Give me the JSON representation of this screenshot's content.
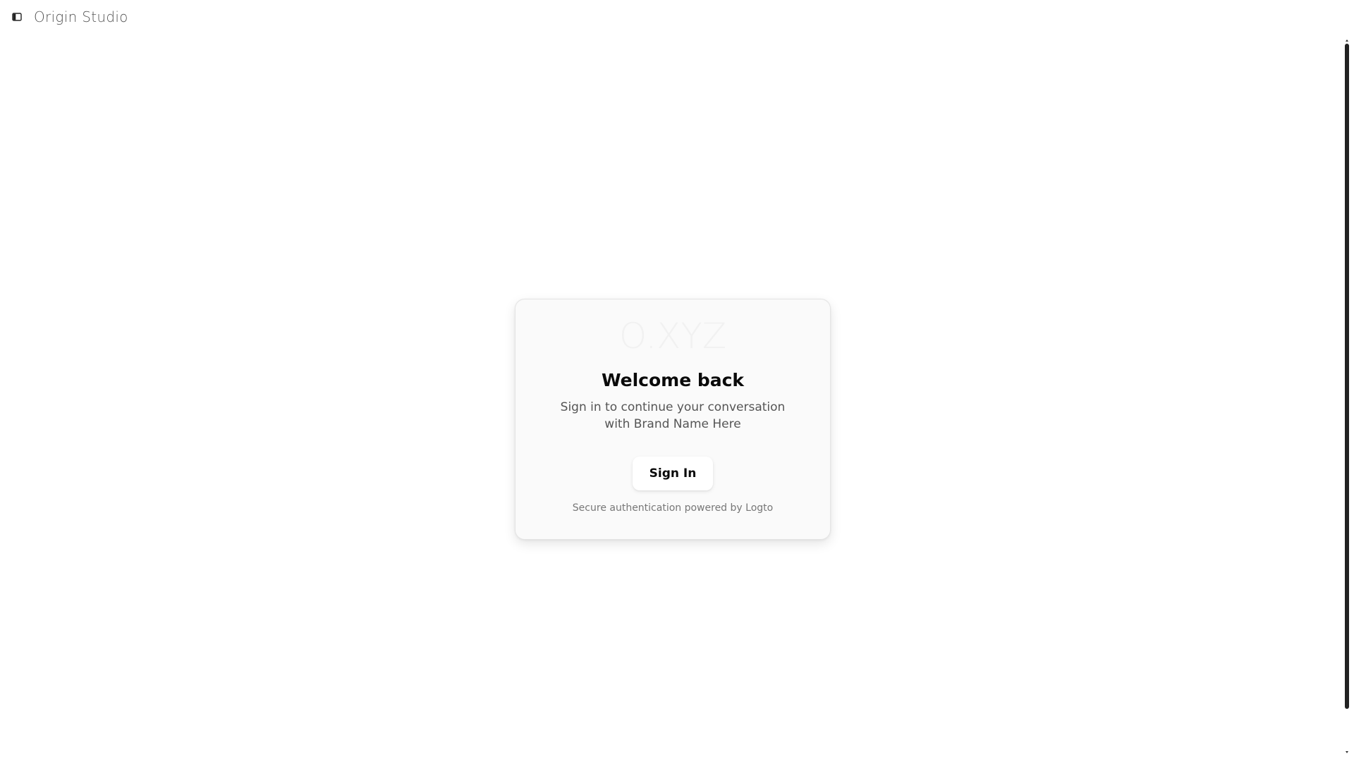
{
  "header": {
    "title": "Origin Studio",
    "toggle_icon": "sidebar-toggle-icon"
  },
  "login_card": {
    "logo_text": "O.XYZ",
    "heading": "Welcome back",
    "subtitle": "Sign in to continue your conversation with Brand Name Here",
    "signin_label": "Sign In",
    "footer": "Secure authentication powered by Logto"
  },
  "colors": {
    "background": "#ffffff",
    "card_background": "#fafafa",
    "heading_text": "#0a0a0a",
    "muted_text": "#555555"
  }
}
